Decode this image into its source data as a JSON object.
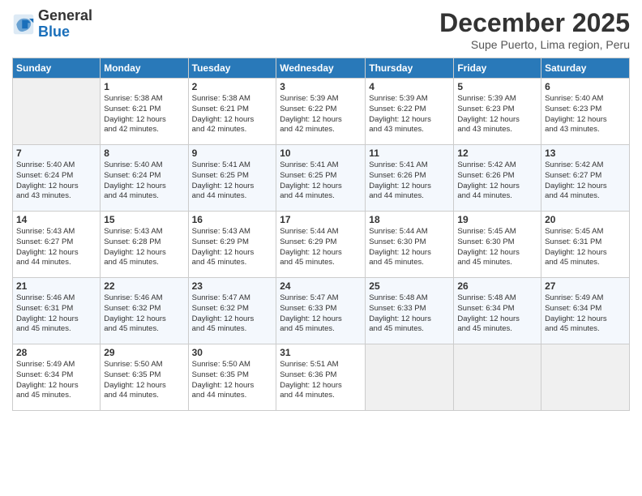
{
  "logo": {
    "line1": "General",
    "line2": "Blue"
  },
  "title": "December 2025",
  "subtitle": "Supe Puerto, Lima region, Peru",
  "days_of_week": [
    "Sunday",
    "Monday",
    "Tuesday",
    "Wednesday",
    "Thursday",
    "Friday",
    "Saturday"
  ],
  "weeks": [
    [
      {
        "day": "",
        "text": ""
      },
      {
        "day": "1",
        "text": "Sunrise: 5:38 AM\nSunset: 6:21 PM\nDaylight: 12 hours\nand 42 minutes."
      },
      {
        "day": "2",
        "text": "Sunrise: 5:38 AM\nSunset: 6:21 PM\nDaylight: 12 hours\nand 42 minutes."
      },
      {
        "day": "3",
        "text": "Sunrise: 5:39 AM\nSunset: 6:22 PM\nDaylight: 12 hours\nand 42 minutes."
      },
      {
        "day": "4",
        "text": "Sunrise: 5:39 AM\nSunset: 6:22 PM\nDaylight: 12 hours\nand 43 minutes."
      },
      {
        "day": "5",
        "text": "Sunrise: 5:39 AM\nSunset: 6:23 PM\nDaylight: 12 hours\nand 43 minutes."
      },
      {
        "day": "6",
        "text": "Sunrise: 5:40 AM\nSunset: 6:23 PM\nDaylight: 12 hours\nand 43 minutes."
      }
    ],
    [
      {
        "day": "7",
        "text": "Sunrise: 5:40 AM\nSunset: 6:24 PM\nDaylight: 12 hours\nand 43 minutes."
      },
      {
        "day": "8",
        "text": "Sunrise: 5:40 AM\nSunset: 6:24 PM\nDaylight: 12 hours\nand 44 minutes."
      },
      {
        "day": "9",
        "text": "Sunrise: 5:41 AM\nSunset: 6:25 PM\nDaylight: 12 hours\nand 44 minutes."
      },
      {
        "day": "10",
        "text": "Sunrise: 5:41 AM\nSunset: 6:25 PM\nDaylight: 12 hours\nand 44 minutes."
      },
      {
        "day": "11",
        "text": "Sunrise: 5:41 AM\nSunset: 6:26 PM\nDaylight: 12 hours\nand 44 minutes."
      },
      {
        "day": "12",
        "text": "Sunrise: 5:42 AM\nSunset: 6:26 PM\nDaylight: 12 hours\nand 44 minutes."
      },
      {
        "day": "13",
        "text": "Sunrise: 5:42 AM\nSunset: 6:27 PM\nDaylight: 12 hours\nand 44 minutes."
      }
    ],
    [
      {
        "day": "14",
        "text": "Sunrise: 5:43 AM\nSunset: 6:27 PM\nDaylight: 12 hours\nand 44 minutes."
      },
      {
        "day": "15",
        "text": "Sunrise: 5:43 AM\nSunset: 6:28 PM\nDaylight: 12 hours\nand 45 minutes."
      },
      {
        "day": "16",
        "text": "Sunrise: 5:43 AM\nSunset: 6:29 PM\nDaylight: 12 hours\nand 45 minutes."
      },
      {
        "day": "17",
        "text": "Sunrise: 5:44 AM\nSunset: 6:29 PM\nDaylight: 12 hours\nand 45 minutes."
      },
      {
        "day": "18",
        "text": "Sunrise: 5:44 AM\nSunset: 6:30 PM\nDaylight: 12 hours\nand 45 minutes."
      },
      {
        "day": "19",
        "text": "Sunrise: 5:45 AM\nSunset: 6:30 PM\nDaylight: 12 hours\nand 45 minutes."
      },
      {
        "day": "20",
        "text": "Sunrise: 5:45 AM\nSunset: 6:31 PM\nDaylight: 12 hours\nand 45 minutes."
      }
    ],
    [
      {
        "day": "21",
        "text": "Sunrise: 5:46 AM\nSunset: 6:31 PM\nDaylight: 12 hours\nand 45 minutes."
      },
      {
        "day": "22",
        "text": "Sunrise: 5:46 AM\nSunset: 6:32 PM\nDaylight: 12 hours\nand 45 minutes."
      },
      {
        "day": "23",
        "text": "Sunrise: 5:47 AM\nSunset: 6:32 PM\nDaylight: 12 hours\nand 45 minutes."
      },
      {
        "day": "24",
        "text": "Sunrise: 5:47 AM\nSunset: 6:33 PM\nDaylight: 12 hours\nand 45 minutes."
      },
      {
        "day": "25",
        "text": "Sunrise: 5:48 AM\nSunset: 6:33 PM\nDaylight: 12 hours\nand 45 minutes."
      },
      {
        "day": "26",
        "text": "Sunrise: 5:48 AM\nSunset: 6:34 PM\nDaylight: 12 hours\nand 45 minutes."
      },
      {
        "day": "27",
        "text": "Sunrise: 5:49 AM\nSunset: 6:34 PM\nDaylight: 12 hours\nand 45 minutes."
      }
    ],
    [
      {
        "day": "28",
        "text": "Sunrise: 5:49 AM\nSunset: 6:34 PM\nDaylight: 12 hours\nand 45 minutes."
      },
      {
        "day": "29",
        "text": "Sunrise: 5:50 AM\nSunset: 6:35 PM\nDaylight: 12 hours\nand 44 minutes."
      },
      {
        "day": "30",
        "text": "Sunrise: 5:50 AM\nSunset: 6:35 PM\nDaylight: 12 hours\nand 44 minutes."
      },
      {
        "day": "31",
        "text": "Sunrise: 5:51 AM\nSunset: 6:36 PM\nDaylight: 12 hours\nand 44 minutes."
      },
      {
        "day": "",
        "text": ""
      },
      {
        "day": "",
        "text": ""
      },
      {
        "day": "",
        "text": ""
      }
    ]
  ]
}
